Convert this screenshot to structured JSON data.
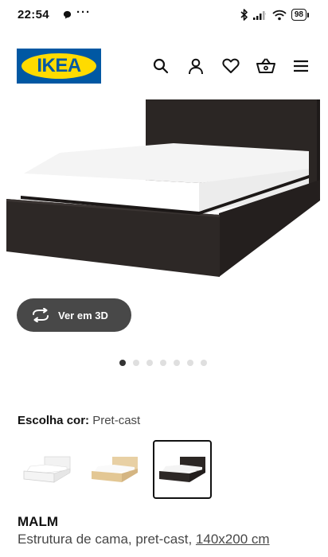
{
  "status_bar": {
    "time": "22:54",
    "more": "···",
    "battery": "98",
    "icons": [
      "message-icon",
      "bluetooth-icon",
      "signal-icon",
      "wifi-icon",
      "battery-icon"
    ]
  },
  "header": {
    "logo_text": "IKEA",
    "icons": [
      "search-icon",
      "user-icon",
      "heart-icon",
      "basket-icon",
      "menu-icon"
    ]
  },
  "product_image": {
    "alt": "MALM bed frame, black-brown"
  },
  "view3d_button": {
    "label": "Ver em 3D",
    "icon": "rotate-icon"
  },
  "carousel": {
    "total": 7,
    "active_index": 0
  },
  "color_choice": {
    "label": "Escolha cor:",
    "value": "Pret-cast",
    "options": [
      {
        "name": "branco",
        "icon": "white-bed-thumbnail"
      },
      {
        "name": "folheado carvalho",
        "icon": "oak-bed-thumbnail"
      },
      {
        "name": "pret-cast",
        "icon": "black-brown-bed-thumbnail",
        "selected": true
      }
    ]
  },
  "product": {
    "name": "MALM",
    "description": "Estrutura de cama, pret-cast, ",
    "size": "140x200 cm"
  },
  "colors": {
    "ikea_blue": "#0058a3",
    "ikea_yellow": "#ffdb00",
    "button_dark": "#484848",
    "bed_frame": "#2a2523"
  }
}
